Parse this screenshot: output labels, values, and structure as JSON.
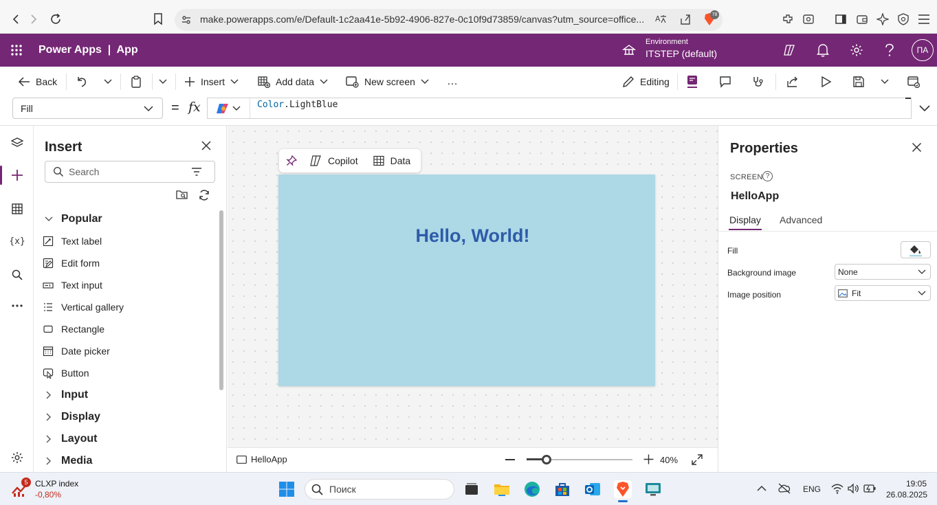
{
  "browser": {
    "url": "make.powerapps.com/e/Default-1c2aa41e-5b92-4906-827e-0c10f9d73859/canvas?utm_source=office...",
    "brave_badge": "78"
  },
  "header": {
    "app_title": "Power Apps  |  App",
    "env_label": "Environment",
    "env_value": "ITSTEP (default)",
    "avatar": "ПА",
    "accent": "#742774"
  },
  "commandbar": {
    "back": "Back",
    "insert": "Insert",
    "add_data": "Add data",
    "new_screen": "New screen",
    "more": "…",
    "editing": "Editing"
  },
  "formula": {
    "property": "Fill",
    "equals": "=",
    "fx": "fx",
    "expr_obj": "Color",
    "expr_member": ".LightBlue"
  },
  "insert_panel": {
    "title": "Insert",
    "search_placeholder": "Search",
    "popular": "Popular",
    "items": [
      "Text label",
      "Edit form",
      "Text input",
      "Vertical gallery",
      "Rectangle",
      "Date picker",
      "Button"
    ],
    "groups": [
      "Input",
      "Display",
      "Layout",
      "Media"
    ]
  },
  "canvas": {
    "float_copilot": "Copilot",
    "float_data": "Data",
    "hello_text": "Hello, World!",
    "screen_fill": "#ADD8E6",
    "screen_tab": "HelloApp",
    "zoom": "40%",
    "zoom_level": 0.19
  },
  "properties": {
    "title": "Properties",
    "kind": "SCREEN",
    "name": "HelloApp",
    "tab_display": "Display",
    "tab_advanced": "Advanced",
    "fill_label": "Fill",
    "bg_image_label": "Background image",
    "bg_image_value": "None",
    "img_pos_label": "Image position",
    "img_pos_value": "Fit"
  },
  "taskbar": {
    "widget_badge": "5",
    "widget_name": "CLXP index",
    "widget_value": "-0,80%",
    "search_placeholder": "Поиск",
    "lang": "ENG",
    "time": "19:05",
    "date": "26.08.2025"
  }
}
